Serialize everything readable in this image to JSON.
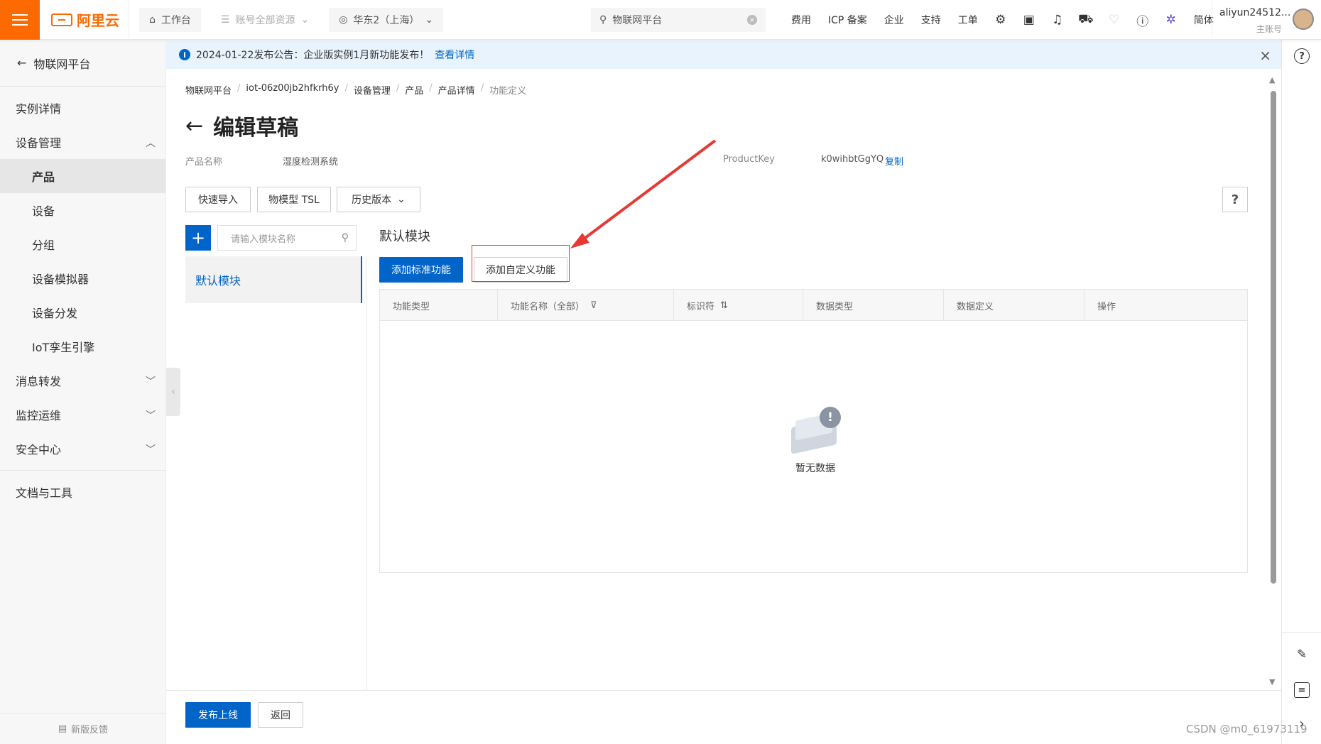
{
  "topbar": {
    "brand": "阿里云",
    "workbench": "工作台",
    "resources": "账号全部资源",
    "region": "华东2（上海）",
    "search_placeholder": "物联网平台",
    "links": [
      "费用",
      "ICP 备案",
      "企业",
      "支持",
      "工单"
    ],
    "lang": "简体",
    "user_name": "aliyun24512...",
    "user_role": "主账号",
    "icons": [
      "api-icon",
      "terminal-icon",
      "bell-icon",
      "cart-icon",
      "bulb-icon",
      "help-icon",
      "star-icon"
    ]
  },
  "sidebar": {
    "back_title": "物联网平台",
    "items": [
      {
        "label": "实例详情"
      },
      {
        "label": "设备管理"
      },
      {
        "label": "产品"
      },
      {
        "label": "设备"
      },
      {
        "label": "分组"
      },
      {
        "label": "设备模拟器"
      },
      {
        "label": "设备分发"
      },
      {
        "label": "IoT孪生引擎"
      },
      {
        "label": "消息转发"
      },
      {
        "label": "监控运维"
      },
      {
        "label": "安全中心"
      },
      {
        "label": "文档与工具"
      }
    ],
    "feedback": "新版反馈"
  },
  "notice": {
    "text": "2024-01-22发布公告：企业版实例1月新功能发布！",
    "link": "查看详情"
  },
  "breadcrumb": [
    "物联网平台",
    "iot-06z00jb2hfkrh6y",
    "设备管理",
    "产品",
    "产品详情",
    "功能定义"
  ],
  "page": {
    "title": "编辑草稿",
    "product_name_label": "产品名称",
    "product_name": "湿度检测系统",
    "product_key_label": "ProductKey",
    "product_key": "k0wihbtGgYQ",
    "copy": "复制",
    "btn_quick_import": "快速导入",
    "btn_tsl": "物模型 TSL",
    "btn_history": "历史版本",
    "help": "?"
  },
  "module_panel": {
    "search_placeholder": "请输入模块名称",
    "add": "+",
    "modules": [
      "默认模块"
    ]
  },
  "content": {
    "section_title": "默认模块",
    "btn_add_standard": "添加标准功能",
    "btn_add_custom": "添加自定义功能",
    "columns": [
      "功能类型",
      "功能名称（全部）",
      "标识符",
      "数据类型",
      "数据定义",
      "操作"
    ],
    "empty_text": "暂无数据"
  },
  "footer": {
    "publish": "发布上线",
    "back": "返回"
  },
  "watermark": "CSDN @m0_61973119",
  "colors": {
    "brand_orange": "#ff6a00",
    "primary_blue": "#0064c8",
    "annotation_red": "#e53935"
  }
}
